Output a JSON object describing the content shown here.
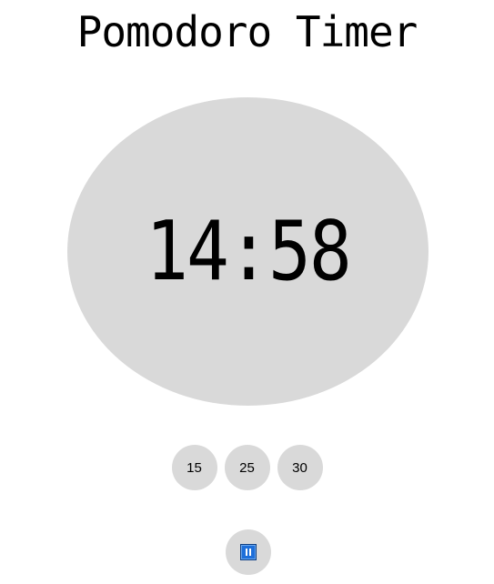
{
  "app": {
    "title": "Pomodoro Timer"
  },
  "timer": {
    "display": "14:58"
  },
  "presets": [
    {
      "label": "15"
    },
    {
      "label": "25"
    },
    {
      "label": "30"
    }
  ],
  "controls": {
    "pause_icon": "pause-icon",
    "accent_color": "#1e6fd9"
  },
  "colors": {
    "surface": "#d9d9d9",
    "background": "#ffffff",
    "text": "#000000"
  }
}
